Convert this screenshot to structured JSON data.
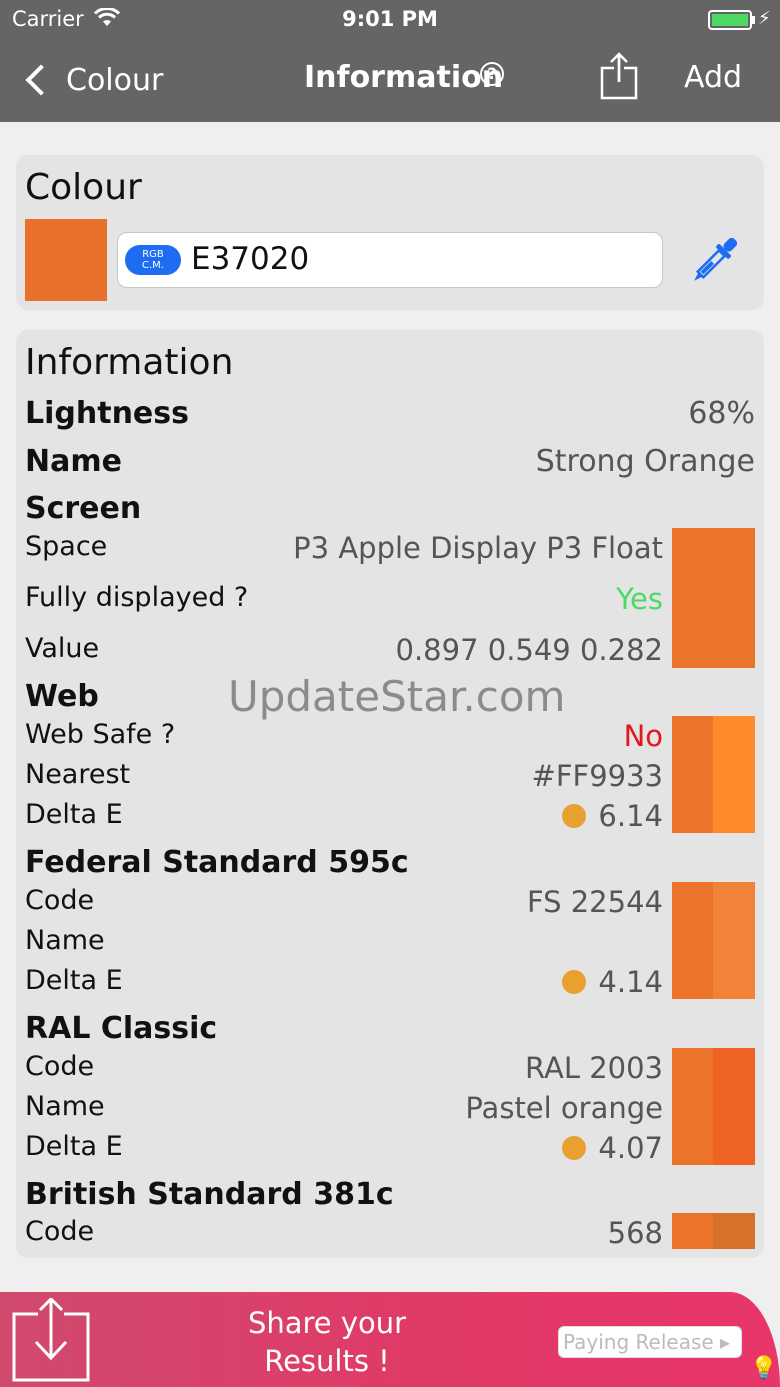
{
  "status_bar": {
    "carrier": "Carrier",
    "time": "9:01 PM"
  },
  "nav": {
    "back_label": "Colour",
    "title": "Information",
    "add_label": "Add"
  },
  "colour_card": {
    "title": "Colour",
    "badge": "RGB\nC.M.",
    "hex_value": "E37020",
    "swatch_color": "#E8702A"
  },
  "info_card": {
    "title": "Information",
    "lightness": {
      "label": "Lightness",
      "value": "68%"
    },
    "name": {
      "label": "Name",
      "value": "Strong Orange"
    },
    "screen": {
      "heading": "Screen",
      "space": {
        "label": "Space",
        "value": "P3 Apple Display P3 Float"
      },
      "fully": {
        "label": "Fully displayed ?",
        "value": "Yes",
        "color": "#4cd964"
      },
      "value": {
        "label": "Value",
        "value": "0.897 0.549 0.282"
      },
      "swatch": "#EC732A"
    },
    "web": {
      "heading": "Web",
      "safe": {
        "label": "Web Safe ?",
        "value": "No",
        "color": "#e3161c"
      },
      "nearest": {
        "label": "Nearest",
        "value": "#FF9933"
      },
      "delta": {
        "label": "Delta E",
        "value": "6.14"
      },
      "swatch_left": "#EC732A",
      "swatch_right": "#FF8A2C"
    },
    "federal": {
      "heading": "Federal Standard 595c",
      "code": {
        "label": "Code",
        "value": "FS 22544"
      },
      "name": {
        "label": "Name",
        "value": ""
      },
      "delta": {
        "label": "Delta E",
        "value": "4.14"
      },
      "swatch_left": "#EC732A",
      "swatch_right": "#F08338"
    },
    "ral": {
      "heading": "RAL Classic",
      "code": {
        "label": "Code",
        "value": "RAL 2003"
      },
      "name": {
        "label": "Name",
        "value": "Pastel orange"
      },
      "delta": {
        "label": "Delta E",
        "value": "4.07"
      },
      "swatch_left": "#EC732A",
      "swatch_right": "#EF6322"
    },
    "british": {
      "heading": "British Standard 381c",
      "code": {
        "label": "Code",
        "value": "568"
      },
      "swatch_left": "#EC732A",
      "swatch_right": "#D8702A"
    }
  },
  "watermark": "UpdateStar.com",
  "banner": {
    "text_line1": "Share your",
    "text_line2": "Results !",
    "paying_label": "Paying Release"
  }
}
